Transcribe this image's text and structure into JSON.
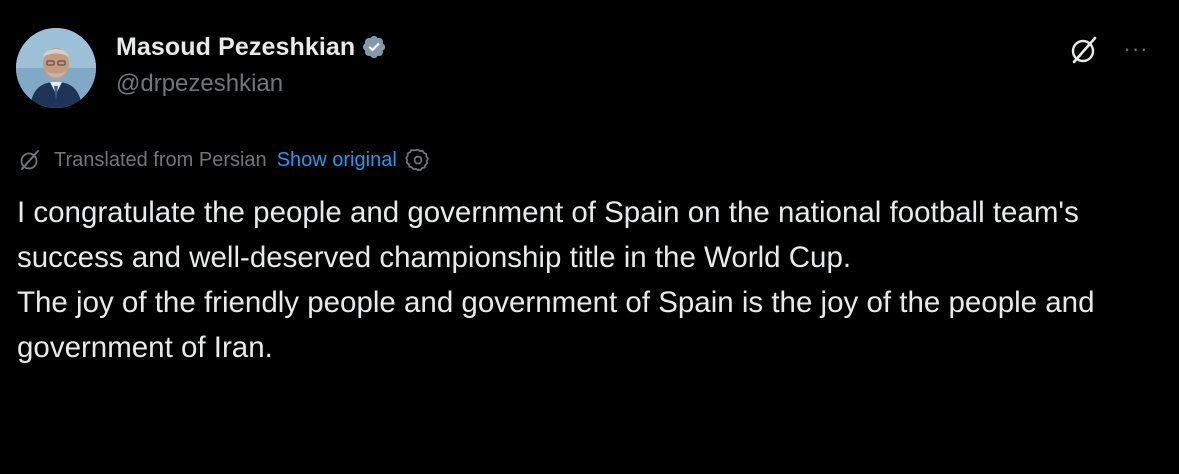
{
  "author": {
    "display_name": "Masoud Pezeshkian",
    "handle": "@drpezeshkian",
    "verified_icon": "verified-badge-icon"
  },
  "actions": {
    "grok_icon": "grok-icon",
    "more_label": "···"
  },
  "translation": {
    "label": "Translated from Persian",
    "show_original": "Show original",
    "translate_icon": "grok-icon",
    "settings_icon": "gear-icon"
  },
  "tweet": {
    "paragraphs": [
      "I congratulate the people and government of Spain on the national football team's success and well-deserved championship title in the World Cup.",
      "The joy of the friendly people and government of Spain is the joy of the people and government of Iran."
    ]
  },
  "colors": {
    "background": "#000000",
    "text": "#e7e9ea",
    "muted": "#71767b",
    "link": "#1d9bf0",
    "verified": "#829aab"
  }
}
